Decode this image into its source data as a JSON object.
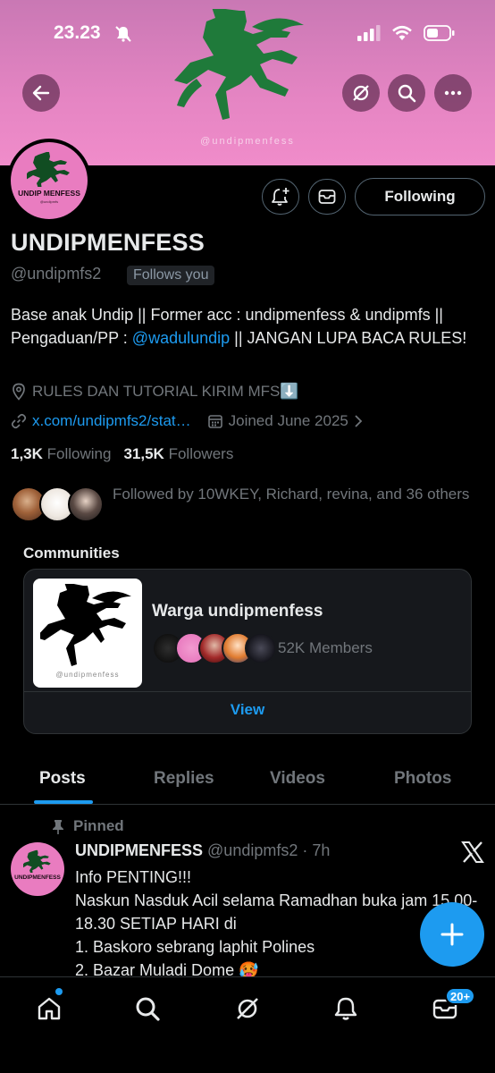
{
  "status_bar": {
    "time": "23.23"
  },
  "banner": {
    "watermark": "@undipmenfess"
  },
  "profile": {
    "avatar_title": "UNDIP MENFESS",
    "avatar_subtitle": "@undipmfs",
    "following_button": "Following",
    "display_name": "UNDIPMENFESS",
    "handle": "@undipmfs2",
    "follows_you": "Follows you",
    "bio_part1": "Base anak Undip || Former acc : undipmenfess & undipmfs || Pengaduan/PP : ",
    "bio_link": "@wadulundip",
    "bio_part2": " || JANGAN LUPA BACA RULES!",
    "location": "RULES DAN TUTORIAL KIRIM MFS⬇️",
    "website": "x.com/undipmfs2/stat…",
    "joined": "Joined June 2025",
    "following_count": "1,3K",
    "following_label": "Following",
    "followers_count": "31,5K",
    "followers_label": "Followers",
    "followed_by": "Followed by 10WKEY, Richard, revina, and 36 others"
  },
  "communities": {
    "title": "Communities",
    "image_caption": "@undipmenfess",
    "name": "Warga undipmenfess",
    "members": "52K Members",
    "view": "View"
  },
  "tabs": [
    "Posts",
    "Replies",
    "Videos",
    "Photos"
  ],
  "post": {
    "pinned_label": "Pinned",
    "author": "UNDIPMENFESS",
    "meta": "@undipmfs2 · 7h",
    "avatar_title": "UNDIPMENFESS",
    "lines": [
      "Info PENTING!!!",
      "Naskun Nasduk Acil selama Ramadhan buka jam 15.00-18.30 SETIAP HARI di",
      "1. Baskoro sebrang laphit Polines",
      "2. Bazar Muladi Dome 🥵"
    ]
  },
  "nav": {
    "messages_badge": "20+"
  },
  "colors": {
    "accent": "#1d9bf0",
    "banner_pink": "#e585c3",
    "horse_green": "#1f7a3a"
  }
}
